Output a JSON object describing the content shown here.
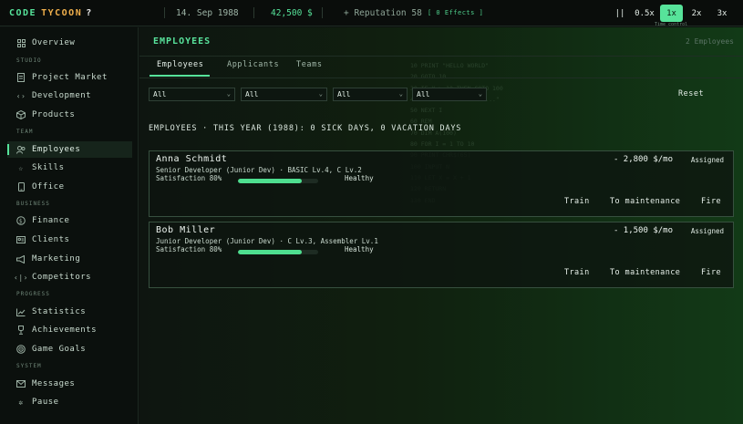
{
  "topbar": {
    "logo_part1": "CODE",
    "logo_part2": "TYCOON",
    "logo_help": "?",
    "date": "14. Sep 1988",
    "money": "42,500 $",
    "reputation": "+ Reputation 58",
    "effects": "[ 0 Effects ]",
    "pause_label": "||",
    "speeds": [
      "0.5x",
      "1x",
      "2x",
      "3x"
    ],
    "active_speed": "1x",
    "speed_caption": "Time control"
  },
  "sidebar": {
    "overview": "Overview",
    "studio_section": "STUDIO",
    "project_market": "Project Market",
    "development": "Development",
    "products": "Products",
    "team_section": "TEAM",
    "employees": "Employees",
    "skills": "Skills",
    "office": "Office",
    "business_section": "BUSINESS",
    "finance": "Finance",
    "clients": "Clients",
    "marketing": "Marketing",
    "competitors": "Competitors",
    "progress_section": "PROGRESS",
    "statistics": "Statistics",
    "achievements": "Achievements",
    "game_goals": "Game Goals",
    "system_section": "SYSTEM",
    "messages": "Messages",
    "pause": "Pause"
  },
  "main": {
    "title": "EMPLOYEES",
    "count": "2 Employees",
    "tabs": [
      "Employees",
      "Applicants",
      "Teams"
    ],
    "filters": [
      "All",
      "All",
      "All",
      "All"
    ],
    "reset": "Reset",
    "summary": "EMPLOYEES  ·  THIS YEAR (1988): 0 SICK DAYS, 0 VACATION DAYS"
  },
  "employees": [
    {
      "name": "Anna Schmidt",
      "role": "Senior Developer (Junior Dev)  ·  BASIC Lv.4, C Lv.2",
      "satisfaction": "Satisfaction 80%",
      "satisfaction_value": 0.8,
      "health": "Healthy",
      "salary": "- 2,800 $/mo",
      "status": "Assigned",
      "actions": [
        "Train",
        "To maintenance",
        "Fire"
      ]
    },
    {
      "name": "Bob Miller",
      "role": "Junior Developer (Junior Dev)  ·  C Lv.3, Assembler Lv.1",
      "satisfaction": "Satisfaction 80%",
      "satisfaction_value": 0.8,
      "health": "Healthy",
      "salary": "- 1,500 $/mo",
      "status": "Assigned",
      "actions": [
        "Train",
        "To maintenance",
        "Fire"
      ]
    }
  ],
  "background_code": "10 PRINT \"HELLO WORLD\"\n20 GOTO 10\n30 IF X > 10 THEN GOTO 100\n40 PRINT \"CALCULATING...\"\n50 NEXT I\n60 REM\n70 DIM A(100)\n80 FOR I = 1 TO 10\n90 PRINT CHR$(65)\n100 INPUT N\n110 LET X = X + 1\n120 RETURN\n130 END",
  "colors": {
    "accent": "#56e39a",
    "logo_secondary": "#f1b04c",
    "background": "#0d120f"
  }
}
